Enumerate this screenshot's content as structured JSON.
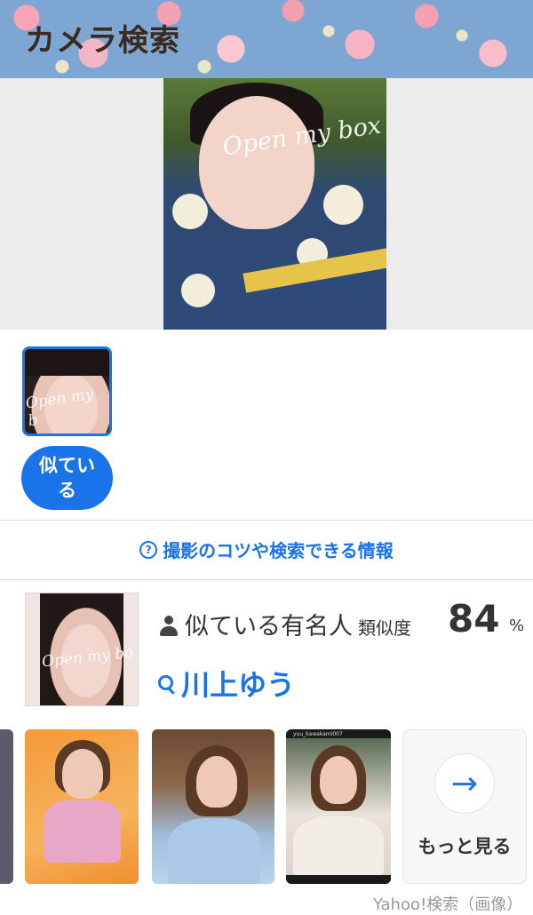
{
  "header": {
    "title": "カメラ検索"
  },
  "main_photo": {
    "watermark": "Open my box"
  },
  "thumbnail": {
    "watermark": "Open my b"
  },
  "similar_button": {
    "label": "似ている"
  },
  "tips_link": {
    "label": "撮影のコツや検索できる情報"
  },
  "result": {
    "label": "似ている有名人",
    "similarity_label": "類似度",
    "score": "84",
    "percent": "%",
    "name": "川上ゆう",
    "thumb_watermark": "Open my bo"
  },
  "carousel": {
    "ig_username": "yuu_kawakami007",
    "more_label": "もっと見る",
    "more_icon": "arrow-right-icon"
  },
  "footer": {
    "attribution": "Yahoo!検索（画像）"
  },
  "colors": {
    "accent": "#1a73e8"
  }
}
